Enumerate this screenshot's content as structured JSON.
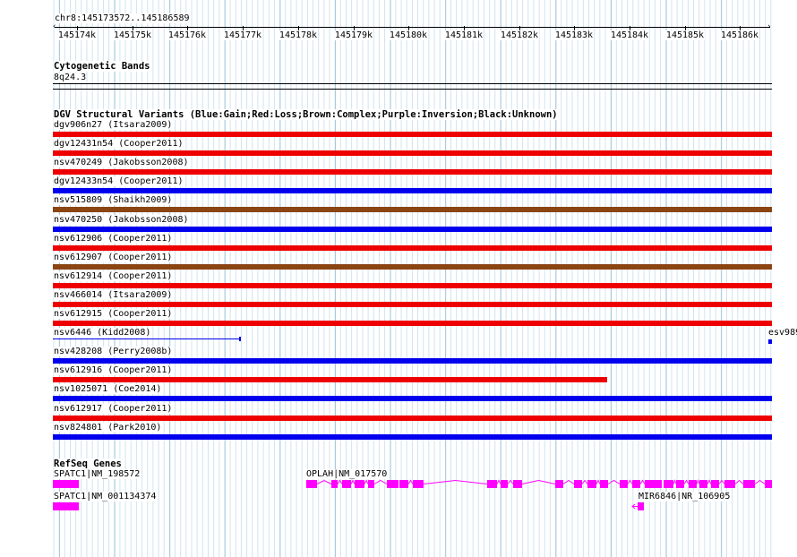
{
  "ruler": {
    "region": "chr8:145173572..145186589",
    "ticks": [
      "145174k",
      "145175k",
      "145176k",
      "145177k",
      "145178k",
      "145179k",
      "145180k",
      "145181k",
      "145182k",
      "145183k",
      "145184k",
      "145185k",
      "145186k"
    ]
  },
  "cyto": {
    "title": "Cytogenetic Bands",
    "band": "8q24.3"
  },
  "dgv": {
    "title": "DGV Structural Variants (Blue:Gain;Red:Loss;Brown:Complex;Purple:Inversion;Black:Unknown)",
    "items": [
      {
        "label": "dgv906n27 (Itsara2009)",
        "type": "loss"
      },
      {
        "label": "dgv12431n54 (Cooper2011)",
        "type": "loss"
      },
      {
        "label": "nsv470249 (Jakobsson2008)",
        "type": "loss"
      },
      {
        "label": "dgv12433n54 (Cooper2011)",
        "type": "gain"
      },
      {
        "label": "nsv515809 (Shaikh2009)",
        "type": "complex"
      },
      {
        "label": "nsv470250 (Jakobsson2008)",
        "type": "gain"
      },
      {
        "label": "nsv612906 (Cooper2011)",
        "type": "loss"
      },
      {
        "label": "nsv612907 (Cooper2011)",
        "type": "complex"
      },
      {
        "label": "nsv612914 (Cooper2011)",
        "type": "loss"
      },
      {
        "label": "nsv466014 (Itsara2009)",
        "type": "loss"
      },
      {
        "label": "nsv612915 (Cooper2011)",
        "type": "loss"
      },
      {
        "label": "nsv6446 (Kidd2008)",
        "type": "thin"
      },
      {
        "label": "nsv428208 (Perry2008b)",
        "type": "gain"
      },
      {
        "label": "nsv612916 (Cooper2011)",
        "type": "loss"
      },
      {
        "label": "nsv1025071 (Coe2014)",
        "type": "gain"
      },
      {
        "label": "nsv612917 (Cooper2011)",
        "type": "loss"
      },
      {
        "label": "nsv824801 (Park2010)",
        "type": "gain"
      }
    ],
    "extra_label": "esv989"
  },
  "refseq": {
    "title": "RefSeq Genes",
    "genes": {
      "g1": "SPATC1|NM_198572",
      "g2": "SPATC1|NM_001134374",
      "g3": "OPLAH|NM_017570",
      "g4": "MIR6846|NR_106905"
    }
  },
  "colors": {
    "gain": "#0000ee",
    "loss": "#ee0000",
    "complex": "#8b4513",
    "gene": "#ff00ff",
    "grid_major": "#a8c8dc",
    "grid_minor": "#d0e4f0"
  }
}
